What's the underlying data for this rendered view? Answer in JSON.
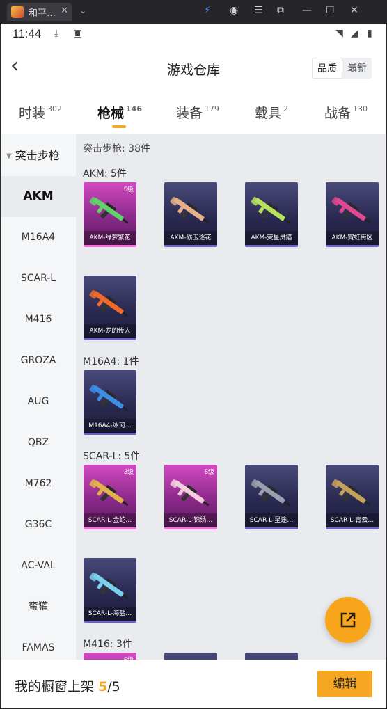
{
  "window": {
    "tab_title": "和平…",
    "close_glyph": "✕",
    "chevron_glyph": "⌄"
  },
  "statusbar": {
    "time": "11:44"
  },
  "header": {
    "back_glyph": "‹",
    "title": "游戏仓库",
    "sort_options": [
      "品质",
      "最新"
    ],
    "sort_selected": "品质"
  },
  "categories": [
    {
      "label": "时装",
      "count": "302",
      "active": false
    },
    {
      "label": "枪械",
      "count": "146",
      "active": true
    },
    {
      "label": "装备",
      "count": "179",
      "active": false
    },
    {
      "label": "载具",
      "count": "2",
      "active": false
    },
    {
      "label": "战备",
      "count": "130",
      "active": false
    }
  ],
  "sidebar": {
    "group_label": "突击步枪",
    "items": [
      "AKM",
      "M16A4",
      "SCAR-L",
      "M416",
      "GROZA",
      "AUG",
      "QBZ",
      "M762",
      "G36C",
      "AC-VAL",
      "蜜獾",
      "FAMAS"
    ],
    "selected": "AKM"
  },
  "content": {
    "subtitle": "突击步枪: 38件",
    "groups": [
      {
        "label": "AKM: 5件",
        "items": [
          {
            "name": "AKM-绿萝繁花",
            "level": "5级",
            "rarity": "gold",
            "color": "#5fd36a"
          },
          {
            "name": "AKM-砺玉逐花",
            "level": "",
            "rarity": "normal",
            "color": "#e6b08a"
          },
          {
            "name": "AKM-荧星灵猫",
            "level": "",
            "rarity": "normal",
            "color": "#b6e25c"
          },
          {
            "name": "AKM-霓虹街区",
            "level": "",
            "rarity": "normal",
            "color": "#e0488f"
          },
          {
            "name": "AKM-龙的传人",
            "level": "",
            "rarity": "normal",
            "color": "#f26a2a"
          }
        ]
      },
      {
        "label": "M16A4: 1件",
        "items": [
          {
            "name": "M16A4-冰河…",
            "level": "",
            "rarity": "normal",
            "color": "#3a8ee6"
          }
        ]
      },
      {
        "label": "SCAR-L: 5件",
        "items": [
          {
            "name": "SCAR-L-金蛇…",
            "level": "3级",
            "rarity": "gold",
            "color": "#e2b24a"
          },
          {
            "name": "SCAR-L-锦绣…",
            "level": "5级",
            "rarity": "gold",
            "color": "#f3cfe0"
          },
          {
            "name": "SCAR-L-星途…",
            "level": "",
            "rarity": "normal",
            "color": "#9aa0b0"
          },
          {
            "name": "SCAR-L-青云…",
            "level": "",
            "rarity": "normal",
            "color": "#c2a25a"
          },
          {
            "name": "SCAR-L-海盐…",
            "level": "",
            "rarity": "normal",
            "color": "#7ad0ee"
          }
        ]
      },
      {
        "label": "M416: 3件",
        "items": [
          {
            "name": "",
            "level": "5级",
            "rarity": "gold",
            "color": "#e26ac0"
          },
          {
            "name": "",
            "level": "",
            "rarity": "normal",
            "color": "#8888aa"
          },
          {
            "name": "",
            "level": "",
            "rarity": "normal",
            "color": "#8888aa"
          }
        ]
      }
    ]
  },
  "footer": {
    "prefix": "我的橱窗上架 ",
    "count": "5",
    "total": "/5",
    "edit_label": "编辑"
  }
}
